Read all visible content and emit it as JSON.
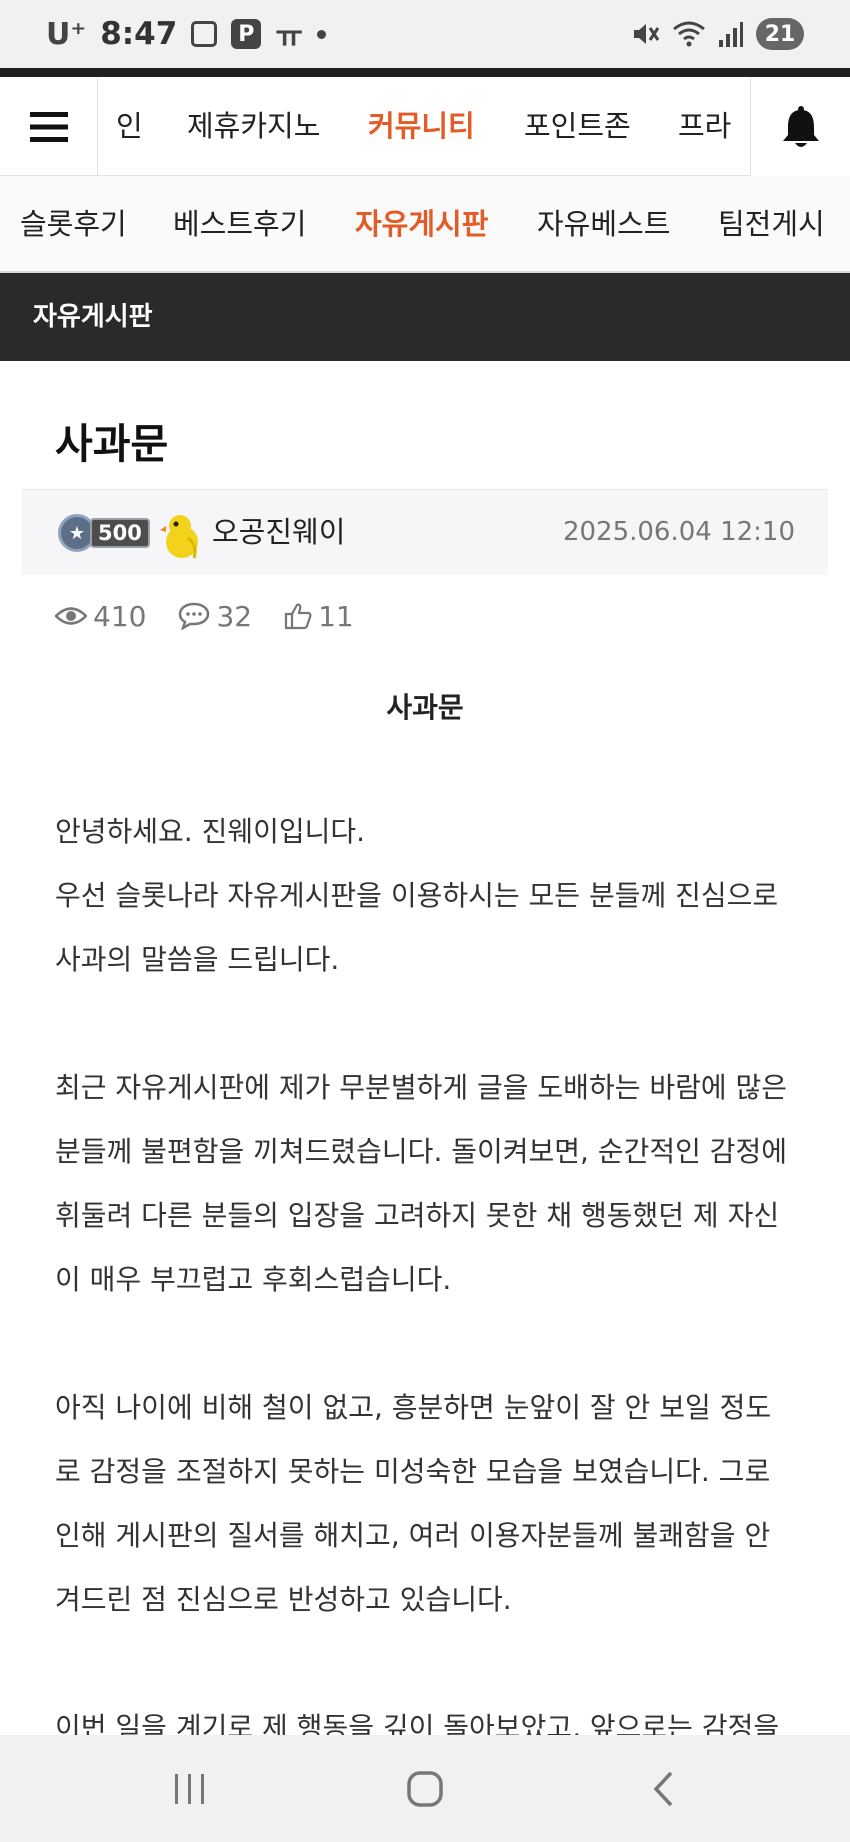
{
  "status_bar": {
    "carrier": "U⁺",
    "time": "8:47",
    "p_icon": "P",
    "t_icon": "ㅠ",
    "battery": "21"
  },
  "main_nav": {
    "items": [
      {
        "label": "인",
        "active": false
      },
      {
        "label": "제휴카지노",
        "active": false
      },
      {
        "label": "커뮤니티",
        "active": true
      },
      {
        "label": "포인트존",
        "active": false
      },
      {
        "label": "프라",
        "active": false
      }
    ]
  },
  "sub_nav": {
    "items": [
      {
        "label": "슬롯후기",
        "active": false
      },
      {
        "label": "베스트후기",
        "active": false
      },
      {
        "label": "자유게시판",
        "active": true
      },
      {
        "label": "자유베스트",
        "active": false
      },
      {
        "label": "팀전게시",
        "active": false
      }
    ]
  },
  "board": {
    "title": "자유게시판"
  },
  "post": {
    "title": "사과문",
    "author": {
      "level": "500",
      "name": "오공진웨이"
    },
    "date": "2025.06.04 12:10",
    "views": "410",
    "comments": "32",
    "likes": "11",
    "content_heading": "사과문",
    "paragraphs": [
      [
        "안녕하세요. 진웨이입니다.",
        "우선 슬롯나라 자유게시판을 이용하시는 모든 분들께 진심으로",
        "사과의 말씀을 드립니다."
      ],
      [
        "최근 자유게시판에 제가 무분별하게 글을 도배하는 바람에 많은",
        "분들께 불편함을 끼쳐드렸습니다. 돌이켜보면, 순간적인 감정에",
        "휘둘려 다른 분들의 입장을 고려하지 못한 채 행동했던 제 자신",
        "이 매우 부끄럽고 후회스럽습니다."
      ],
      [
        "아직 나이에 비해 철이 없고, 흥분하면 눈앞이 잘 안 보일 정도",
        "로 감정을 조절하지 못하는 미성숙한 모습을 보였습니다. 그로",
        "인해 게시판의 질서를 해치고, 여러 이용자분들께 불쾌함을 안",
        "겨드린 점 진심으로 반성하고 있습니다."
      ],
      [
        "이번 일을 계기로 제 행동을 깊이 돌아보았고, 앞으로는 감정을"
      ]
    ]
  },
  "colors": {
    "accent": "#e35b26",
    "board_header_bg": "#2a2a2a"
  }
}
